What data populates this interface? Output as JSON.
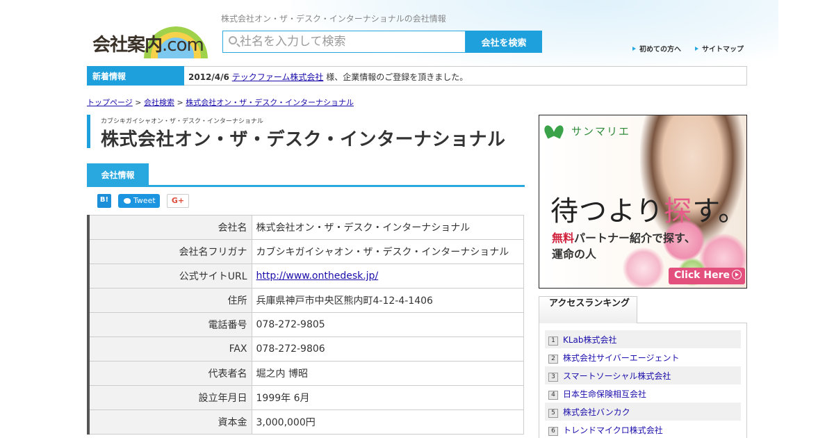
{
  "header": {
    "logo_text": "会社案内",
    "logo_suffix": ".com",
    "tagline": "株式会社オン・ザ・デスク・インターナショナルの会社情報",
    "search_placeholder": "社名を入力して検索",
    "search_button": "会社を検索",
    "links": [
      "初めての方へ",
      "サイトマップ"
    ]
  },
  "news": {
    "label": "新着情報",
    "date": "2012/4/6",
    "company_link": "テックファーム株式会社",
    "message": "様、企業情報のご登録を頂きました。"
  },
  "breadcrumb": [
    "トップページ",
    "会社検索",
    "株式会社オン・ザ・デスク・インターナショナル"
  ],
  "breadcrumb_sep": ">",
  "company": {
    "furigana": "カブシキガイシャオン・ザ・デスク・インターナショナル",
    "title": "株式会社オン・ザ・デスク・インターナショナル"
  },
  "tab_label": "会社情報",
  "share": {
    "hatena": "B!",
    "tweet": "Tweet",
    "gplus": "G+"
  },
  "info_rows": [
    {
      "label": "会社名",
      "value": "株式会社オン・ザ・デスク・インターナショナル"
    },
    {
      "label": "会社名フリガナ",
      "value": "カブシキガイシャオン・ザ・デスク・インターナショナル"
    },
    {
      "label": "公式サイトURL",
      "value": "http://www.onthedesk.jp/"
    },
    {
      "label": "住所",
      "value": "兵庫県神戸市中央区熊内町4-12-4-1406"
    },
    {
      "label": "電話番号",
      "value": "078-272-9805"
    },
    {
      "label": "FAX",
      "value": "078-272-9806"
    },
    {
      "label": "代表者名",
      "value": "堀之内 博昭"
    },
    {
      "label": "設立年月日",
      "value": "1999年 6月"
    },
    {
      "label": "資本金",
      "value": "3,000,000円"
    }
  ],
  "ad": {
    "brand": "サンマリエ",
    "headline_a": "待つより",
    "headline_b": "探",
    "headline_c": "す。",
    "sub1_red": "無料",
    "sub1_rest": "パートナー紹介で探す、",
    "sub2": "運命の人",
    "click": "Click Here",
    "accent_color": "#e3507e"
  },
  "ranking": {
    "title": "アクセスランキング",
    "items": [
      {
        "num": "1",
        "name": "KLab株式会社"
      },
      {
        "num": "2",
        "name": "株式会社サイバーエージェント"
      },
      {
        "num": "3",
        "name": "スマートソーシャル株式会社"
      },
      {
        "num": "4",
        "name": "日本生命保険相互会社"
      },
      {
        "num": "5",
        "name": "株式会社バンカク"
      },
      {
        "num": "6",
        "name": "トレンドマイクロ株式会社"
      }
    ]
  },
  "colors": {
    "accent": "#1da0dc",
    "link": "#1a0dab"
  }
}
